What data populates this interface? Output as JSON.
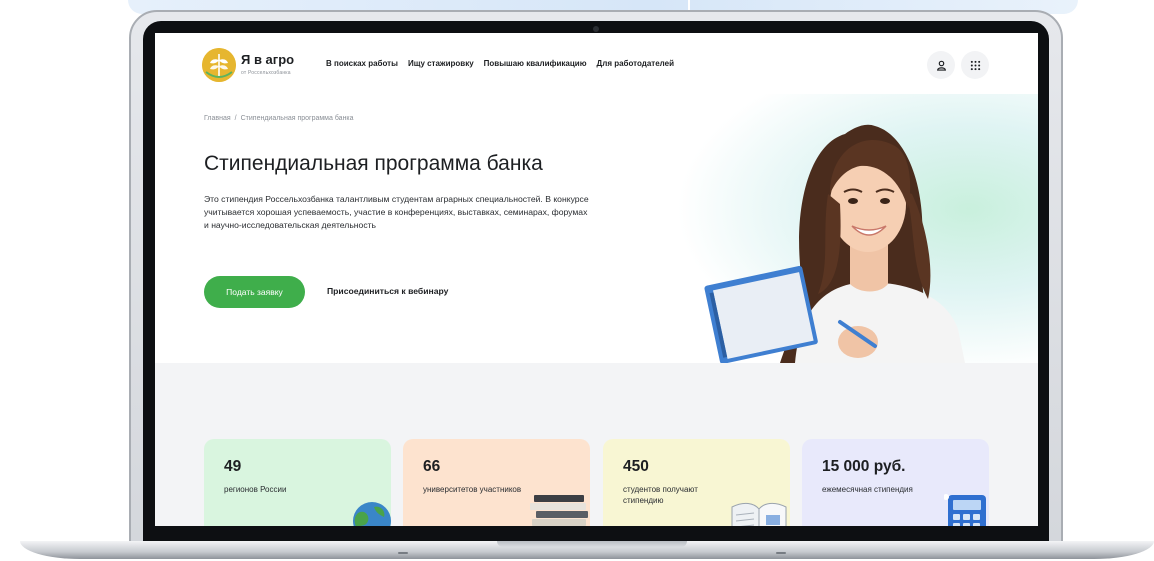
{
  "header": {
    "logo_title": "Я в агро",
    "logo_subtitle": "от Россельхозбанка",
    "nav": [
      {
        "label": "В поисках работы"
      },
      {
        "label": "Ищу стажировку"
      },
      {
        "label": "Повышаю квалификацию"
      },
      {
        "label": "Для работодателей"
      }
    ],
    "icons": [
      "user-icon",
      "apps-grid-icon"
    ]
  },
  "breadcrumb": {
    "home": "Главная",
    "separator": "/",
    "current": "Стипендиальная программа банка"
  },
  "hero": {
    "title": "Стипендиальная программа банка",
    "description": "Это стипендия Россельхозбанка талантливым студентам аграрных специальностей. В конкурсе учитывается хорошая успеваемость, участие в конференциях, выставках, семинарах, форумах и научно-исследовательская деятельность",
    "apply_button": "Подать заявку",
    "webinar_link": "Присоединиться к вебинару"
  },
  "stats": [
    {
      "value": "49",
      "label": "регионов России",
      "color": "#d9f5df",
      "icon": "globe-icon"
    },
    {
      "value": "66",
      "label": "университетов участников",
      "color": "#fde3cf",
      "icon": "books-icon"
    },
    {
      "value": "450",
      "label": "студентов получают стипендию",
      "color": "#f8f6d3",
      "icon": "open-book-icon"
    },
    {
      "value": "15 000 руб.",
      "label": "ежемесячная стипендия",
      "color": "#e8e9fb",
      "icon": "calculator-icon"
    }
  ],
  "colors": {
    "accent_green": "#3fae4b",
    "logo_yellow": "#e6b62f",
    "page_background": "#f3f4f6"
  }
}
